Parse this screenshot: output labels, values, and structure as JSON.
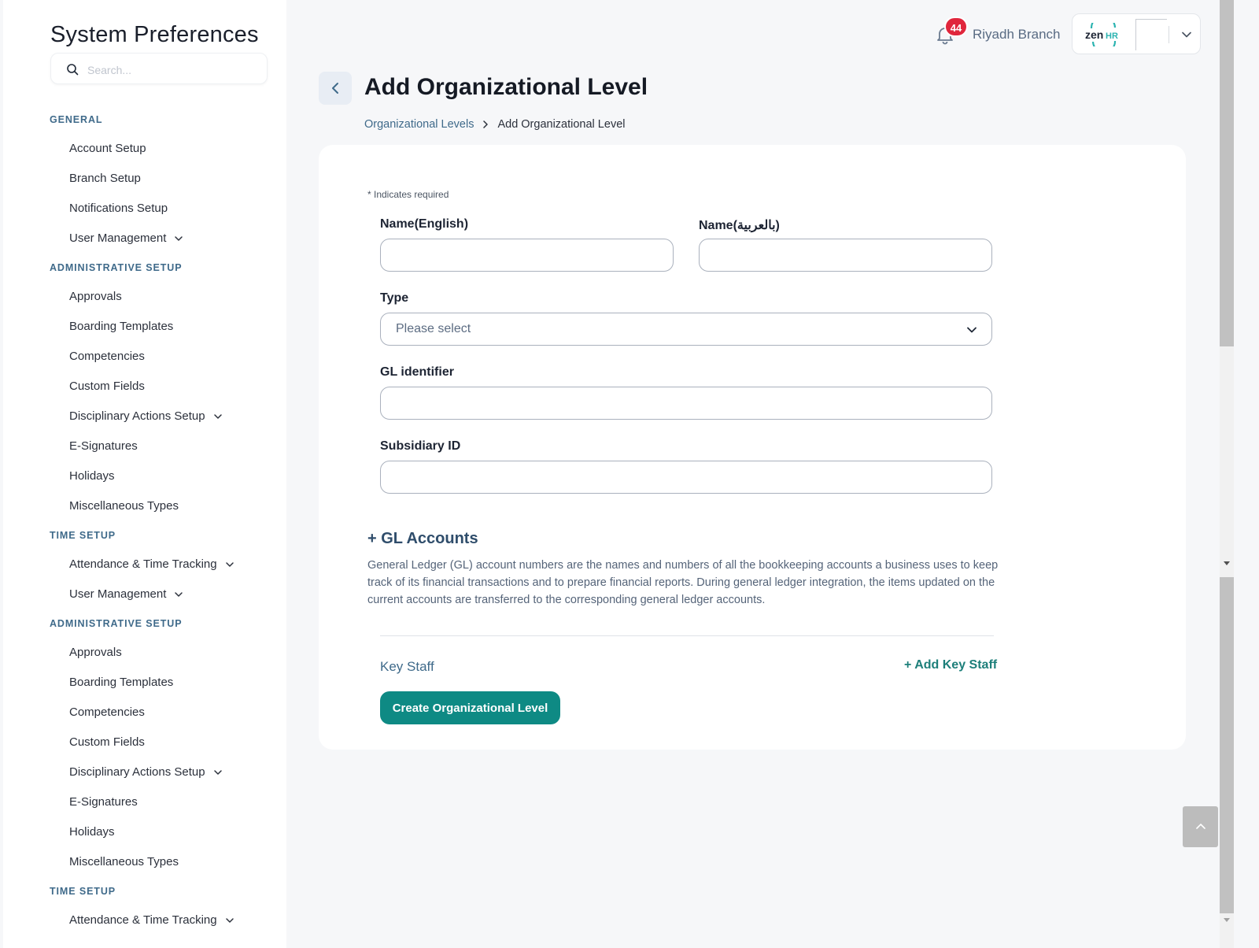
{
  "sidebar": {
    "title": "System Preferences",
    "search_placeholder": "Search...",
    "entries": [
      {
        "kind": "section",
        "label": "GENERAL"
      },
      {
        "kind": "item",
        "label": "Account Setup"
      },
      {
        "kind": "item",
        "label": "Branch Setup"
      },
      {
        "kind": "item",
        "label": "Notifications Setup"
      },
      {
        "kind": "item",
        "label": "User Management",
        "expandable": true
      },
      {
        "kind": "section",
        "label": "ADMINISTRATIVE SETUP"
      },
      {
        "kind": "item",
        "label": "Approvals"
      },
      {
        "kind": "item",
        "label": "Boarding Templates"
      },
      {
        "kind": "item",
        "label": "Competencies"
      },
      {
        "kind": "item",
        "label": "Custom Fields"
      },
      {
        "kind": "item",
        "label": "Disciplinary Actions Setup",
        "expandable": true
      },
      {
        "kind": "item",
        "label": "E-Signatures"
      },
      {
        "kind": "item",
        "label": "Holidays"
      },
      {
        "kind": "item",
        "label": "Miscellaneous Types"
      },
      {
        "kind": "section",
        "label": "TIME SETUP"
      },
      {
        "kind": "item",
        "label": "Attendance & Time Tracking",
        "expandable": true
      },
      {
        "kind": "item",
        "label": "User Management",
        "expandable": true
      },
      {
        "kind": "section",
        "label": "ADMINISTRATIVE SETUP"
      },
      {
        "kind": "item",
        "label": "Approvals"
      },
      {
        "kind": "item",
        "label": "Boarding Templates"
      },
      {
        "kind": "item",
        "label": "Competencies"
      },
      {
        "kind": "item",
        "label": "Custom Fields"
      },
      {
        "kind": "item",
        "label": "Disciplinary Actions Setup",
        "expandable": true
      },
      {
        "kind": "item",
        "label": "E-Signatures"
      },
      {
        "kind": "item",
        "label": "Holidays"
      },
      {
        "kind": "item",
        "label": "Miscellaneous Types"
      },
      {
        "kind": "section",
        "label": "TIME SETUP"
      },
      {
        "kind": "item",
        "label": "Attendance & Time Tracking",
        "expandable": true
      }
    ]
  },
  "header": {
    "notification_count": "44",
    "branch_name": "Riyadh Branch",
    "logo_text_zen": "zen",
    "logo_text_hr": "HR",
    "bell_icon": "bell-icon",
    "chevron_icon": "chevron-down-icon"
  },
  "page": {
    "title": "Add Organizational Level",
    "breadcrumb": {
      "parent": "Organizational Levels",
      "current": "Add Organizational Level"
    }
  },
  "form": {
    "required_note": "* Indicates required",
    "name_en_label": "Name(English)",
    "name_ar_label": "Name(بالعربية)",
    "name_en_value": "",
    "name_ar_value": "",
    "type_label": "Type",
    "type_placeholder": "Please select",
    "gl_identifier_label": "GL identifier",
    "gl_identifier_value": "",
    "subsidiary_label": "Subsidiary ID",
    "subsidiary_value": "",
    "gl_accounts_title": "+ GL Accounts",
    "gl_accounts_description": "General Ledger (GL) account numbers are the names and numbers of all the bookkeeping accounts a business uses to keep track of its financial transactions and to prepare financial reports. During general ledger integration, the items updated on the current accounts are transferred to the corresponding general ledger accounts.",
    "key_staff_label": "Key Staff",
    "add_key_staff_label": "+ Add Key Staff",
    "submit_label": "Create Organizational Level"
  },
  "colors": {
    "primary": "#0e8a84",
    "link": "#3f6a8a",
    "badge": "#e0263c"
  }
}
